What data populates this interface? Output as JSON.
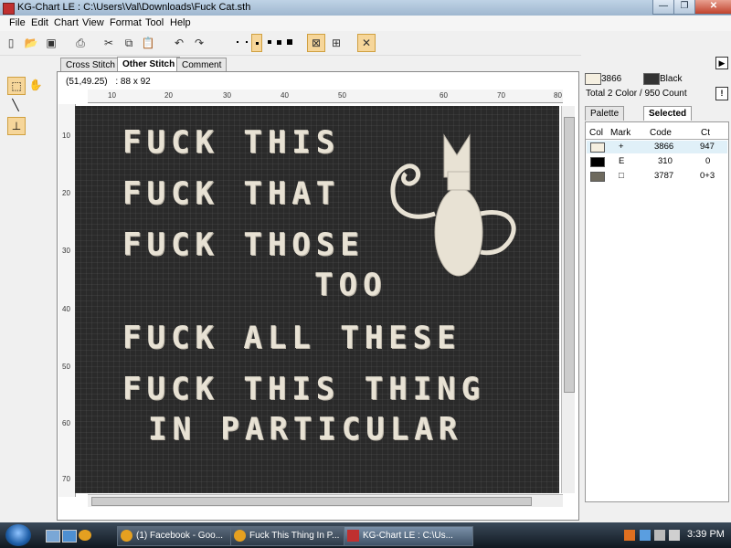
{
  "window": {
    "title": "KG-Chart LE : C:\\Users\\Val\\Downloads\\Fuck Cat.sth",
    "minimize": "—",
    "restore": "❐",
    "close": "✕"
  },
  "menu": [
    "File",
    "Edit",
    "Chart",
    "View",
    "Format",
    "Tool",
    "Help"
  ],
  "tabs": {
    "cross_stitch": "Cross Stitch",
    "other_stitch": "Other Stitch",
    "comment": "Comment"
  },
  "canvas": {
    "coords": "(51,49.25)",
    "size": ": 88 x 92",
    "ruler_h": [
      "10",
      "20",
      "30",
      "40",
      "50",
      "60",
      "70",
      "80"
    ],
    "ruler_v": [
      "10",
      "20",
      "30",
      "40",
      "50",
      "60",
      "70"
    ]
  },
  "chart_text": {
    "line1": "FUCK THIS",
    "line2": "FUCK THAT",
    "line3": "FUCK THOSE",
    "line4": "TOO",
    "line5": "FUCK ALL THESE",
    "line6": "FUCK THIS THING",
    "line7": "IN PARTICULAR"
  },
  "colors": {
    "fabric": "#2a2a2a",
    "stitch": "#e8e2d4",
    "swatch_3866": "#f5efe0",
    "swatch_black": "#333333",
    "swatch_310": "#000000",
    "swatch_3787": "#6e6a5e"
  },
  "right_panel": {
    "swatch1_code": "3866",
    "swatch2_name": "Black",
    "totals": "Total 2 Color / 950 Count",
    "info_btn": "!",
    "expand_btn": "▶",
    "tab_palette": "Palette",
    "tab_selected": "Selected",
    "table_headers": {
      "col": "Col",
      "mark": "Mark",
      "code": "Code",
      "ct": "Ct"
    },
    "rows": [
      {
        "mark": "+",
        "code": "3866",
        "ct": "947"
      },
      {
        "mark": "E",
        "code": "310",
        "ct": "0"
      },
      {
        "mark": "□",
        "code": "3787",
        "ct": "0+3"
      }
    ]
  },
  "taskbar": {
    "tasks": [
      "(1) Facebook - Goo...",
      "Fuck This Thing In P...",
      "KG-Chart LE : C:\\Us..."
    ],
    "clock": "3:39 PM"
  }
}
